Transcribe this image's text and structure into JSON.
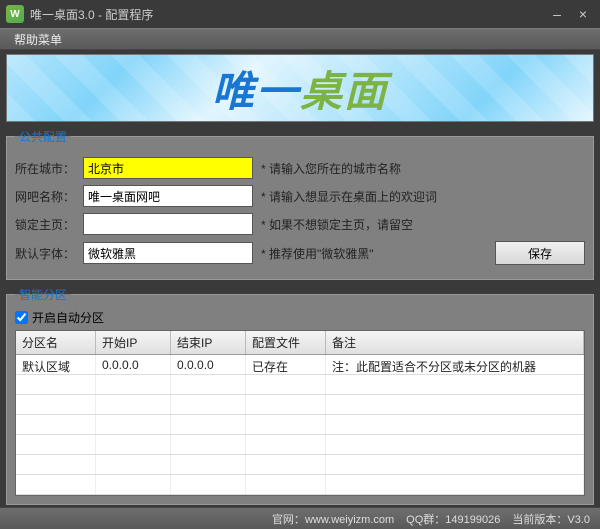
{
  "titlebar": {
    "title": "唯一桌面3.0 - 配置程序"
  },
  "menubar": {
    "help": "帮助菜单"
  },
  "banner": {
    "text_a": "唯一",
    "text_b": "桌面"
  },
  "public_config": {
    "legend": "公共配置",
    "city_label": "所在城市：",
    "city_value": "北京市",
    "city_hint": "* 请输入您所在的城市名称",
    "bar_label": "网吧名称：",
    "bar_value": "唯一桌面网吧",
    "bar_hint": "* 请输入想显示在桌面上的欢迎词",
    "lock_label": "锁定主页：",
    "lock_value": "",
    "lock_hint": "* 如果不想锁定主页，请留空",
    "font_label": "默认字体：",
    "font_value": "微软雅黑",
    "font_hint": "* 推荐使用\"微软雅黑\"",
    "save_label": "保存"
  },
  "smart_zone": {
    "legend": "智能分区",
    "enable_label": "开启自动分区",
    "enable_checked": true,
    "headers": {
      "name": "分区名",
      "start_ip": "开始IP",
      "end_ip": "结束IP",
      "config": "配置文件",
      "remark": "备注"
    },
    "rows": [
      {
        "name": "默认区域",
        "start_ip": "0.0.0.0",
        "end_ip": "0.0.0.0",
        "config": "已存在",
        "remark": "注：此配置适合不分区或未分区的机器"
      }
    ]
  },
  "statusbar": {
    "site_label": "官网：",
    "site_url": "www.weiyizm.com",
    "qq_label": "QQ群：",
    "qq_value": "149199026",
    "ver_label": "当前版本：",
    "ver_value": "V3.0"
  }
}
